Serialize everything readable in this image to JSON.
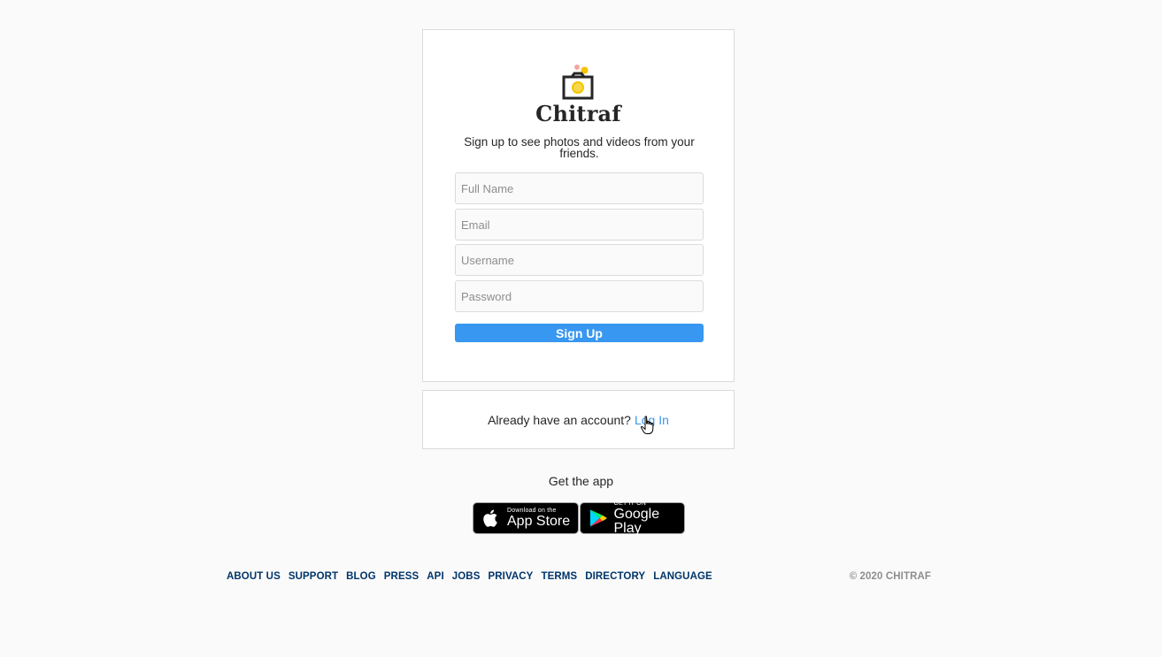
{
  "brand": {
    "name": "Chitraf",
    "icon": "camera-logo-icon",
    "accent_colors": [
      "#f6a7a0",
      "#f4c400"
    ]
  },
  "signup": {
    "tagline": "Sign up to see photos and videos from your friends.",
    "fields": {
      "full_name_placeholder": "Full Name",
      "email_placeholder": "Email",
      "username_placeholder": "Username",
      "password_placeholder": "Password"
    },
    "button_label": "Sign Up",
    "button_color": "#3897f0"
  },
  "login_prompt": {
    "question": "Already have an account?",
    "link_label": "Log In"
  },
  "get_app": {
    "label": "Get the app",
    "app_store": {
      "small": "Download on the",
      "big": "App Store",
      "icon": "apple-icon"
    },
    "google_play": {
      "small": "GET IT ON",
      "big": "Google Play",
      "icon": "google-play-icon"
    }
  },
  "footer": {
    "links": [
      "ABOUT US",
      "SUPPORT",
      "BLOG",
      "PRESS",
      "API",
      "JOBS",
      "PRIVACY",
      "TERMS",
      "DIRECTORY",
      "LANGUAGE"
    ],
    "copyright": "© 2020 CHITRAF"
  }
}
